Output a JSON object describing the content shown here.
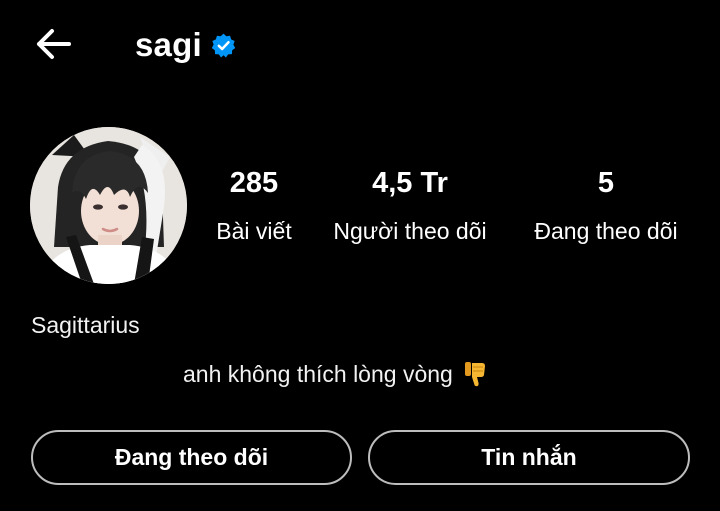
{
  "header": {
    "username": "sagi",
    "verified_icon": "verified-badge-icon",
    "back_icon": "back-arrow-icon"
  },
  "stats": [
    {
      "value": "285",
      "label": "Bài viết"
    },
    {
      "value": "4,5 Tr",
      "label": "Người theo dõi"
    },
    {
      "value": "5",
      "label": "Đang theo dõi"
    }
  ],
  "profile": {
    "display_name": "Sagittarius",
    "bio": "anh không thích lòng vòng",
    "bio_emoji": "thumbs-down-icon"
  },
  "buttons": {
    "following": "Đang theo dõi",
    "message": "Tin nhắn"
  },
  "colors": {
    "background": "#000000",
    "text": "#ffffff",
    "verified_badge": "#0095f6",
    "button_border": "#bdbdbd",
    "emoji": "#f5b731"
  }
}
